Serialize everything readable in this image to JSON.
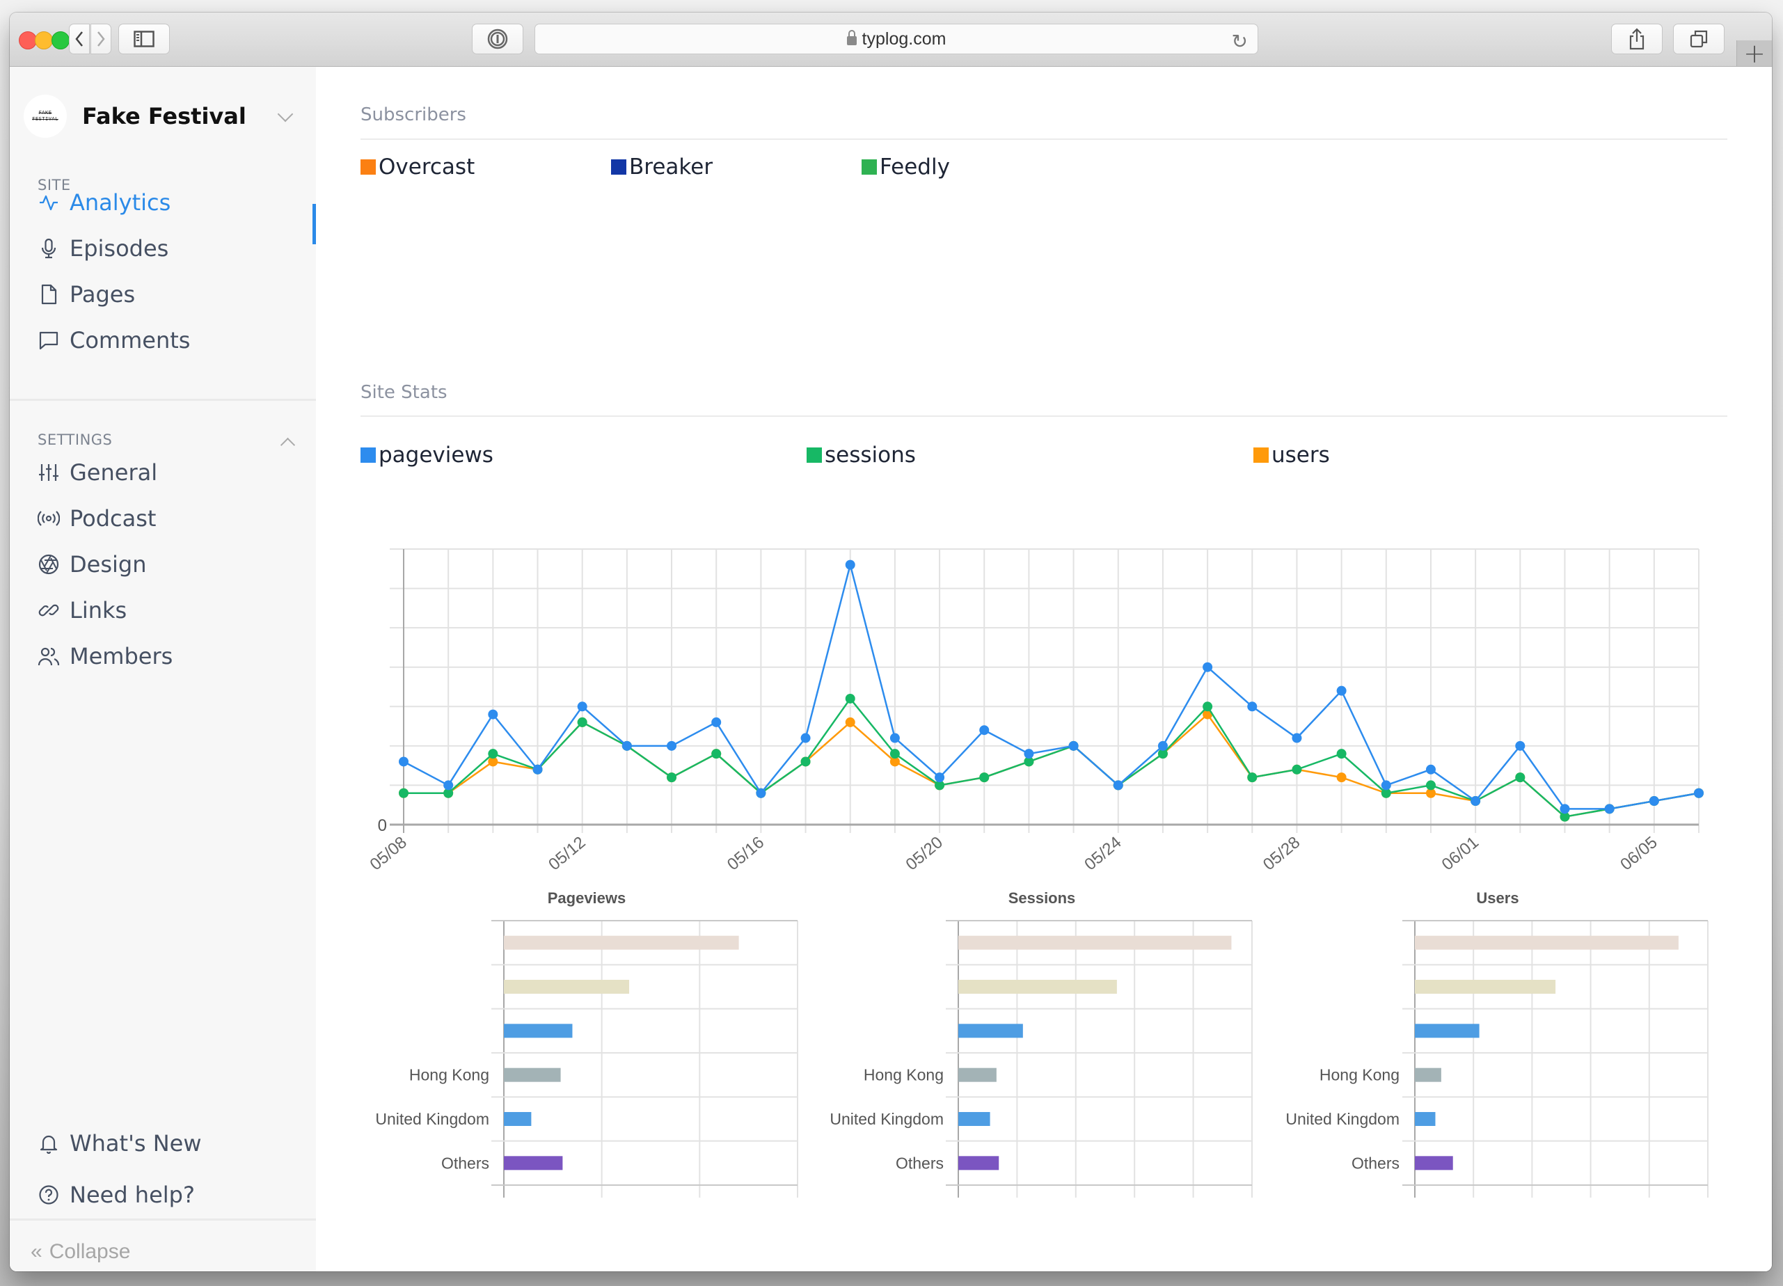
{
  "browser": {
    "url": "typlog.com",
    "buttons": {
      "back": "chevron-left-icon",
      "forward": "chevron-right-icon",
      "sidebar": "sidebar-icon",
      "password": "1password-icon",
      "reload": "reload-icon",
      "share": "share-icon",
      "tabs": "tabs-icon",
      "new_tab": "+"
    }
  },
  "sidebar": {
    "site_name": "Fake Festival",
    "logo_text": [
      "FAKE",
      "FESTIVAL"
    ],
    "site_section_label": "SITE",
    "site_items": [
      {
        "label": "Analytics",
        "icon": "activity-icon",
        "active": true
      },
      {
        "label": "Episodes",
        "icon": "microphone-icon",
        "active": false
      },
      {
        "label": "Pages",
        "icon": "file-icon",
        "active": false
      },
      {
        "label": "Comments",
        "icon": "comment-icon",
        "active": false
      }
    ],
    "settings_section_label": "SETTINGS",
    "settings_items": [
      {
        "label": "General",
        "icon": "sliders-icon"
      },
      {
        "label": "Podcast",
        "icon": "broadcast-icon"
      },
      {
        "label": "Design",
        "icon": "aperture-icon"
      },
      {
        "label": "Links",
        "icon": "link-icon"
      },
      {
        "label": "Members",
        "icon": "users-icon"
      }
    ],
    "footer_items": [
      {
        "label": "What's New",
        "icon": "bell-icon"
      },
      {
        "label": "Need help?",
        "icon": "help-circle-icon"
      }
    ],
    "collapse_label": "Collapse",
    "accent_color": "#2b8ae8"
  },
  "subscribers": {
    "title": "Subscribers",
    "legend": [
      {
        "label": "Overcast",
        "color": "#fb8013"
      },
      {
        "label": "Breaker",
        "color": "#1237a6"
      },
      {
        "label": "Feedly",
        "color": "#2fb252"
      }
    ]
  },
  "site_stats": {
    "title": "Site Stats",
    "legend": [
      {
        "label": "pageviews",
        "color": "#2d8cee"
      },
      {
        "label": "sessions",
        "color": "#17b865"
      },
      {
        "label": "users",
        "color": "#ff9a0a"
      }
    ]
  },
  "chart_data": [
    {
      "type": "line",
      "title": "Site Stats",
      "xlabel": "",
      "ylabel": "",
      "grid": true,
      "y_tick_labels": [
        "0"
      ],
      "ylim": [
        0,
        35
      ],
      "note": "y values are relative units (one horizontal gridline = 5 units); only the 0 tick is labeled",
      "x": [
        "05/08",
        "05/09",
        "05/10",
        "05/11",
        "05/12",
        "05/13",
        "05/14",
        "05/15",
        "05/16",
        "05/17",
        "05/18",
        "05/19",
        "05/20",
        "05/21",
        "05/22",
        "05/23",
        "05/24",
        "05/25",
        "05/26",
        "05/27",
        "05/28",
        "05/29",
        "05/30",
        "05/31",
        "06/01",
        "06/02",
        "06/03",
        "06/04",
        "06/05",
        "06/06"
      ],
      "x_tick_labels": [
        "05/08",
        "05/12",
        "05/16",
        "05/20",
        "05/24",
        "05/28",
        "06/01",
        "06/05"
      ],
      "series": [
        {
          "name": "users",
          "color": "#ff9a0a",
          "values": [
            4,
            4,
            8,
            7,
            13,
            10,
            6,
            9,
            4,
            8,
            13,
            8,
            5,
            6,
            8,
            10,
            5,
            9,
            14,
            6,
            7,
            6,
            4,
            4,
            3,
            6,
            1,
            2,
            3,
            4
          ]
        },
        {
          "name": "sessions",
          "color": "#17b865",
          "values": [
            4,
            4,
            9,
            7,
            13,
            10,
            6,
            9,
            4,
            8,
            16,
            9,
            5,
            6,
            8,
            10,
            5,
            9,
            15,
            6,
            7,
            9,
            4,
            5,
            3,
            6,
            1,
            2,
            3,
            4
          ]
        },
        {
          "name": "pageviews",
          "color": "#2d8cee",
          "values": [
            8,
            5,
            14,
            7,
            15,
            10,
            10,
            13,
            4,
            11,
            33,
            11,
            6,
            12,
            9,
            10,
            5,
            10,
            20,
            15,
            11,
            17,
            5,
            7,
            3,
            10,
            2,
            2,
            3,
            4
          ]
        }
      ]
    },
    {
      "type": "bar",
      "orientation": "horizontal",
      "title": "Pageviews",
      "note": "values in gridline units (axis shows 3 unlabeled gridline intervals)",
      "xlim": [
        0,
        3
      ],
      "categories": [
        "",
        "",
        "",
        "Hong Kong",
        "United Kingdom",
        "Others"
      ],
      "values": [
        2.4,
        1.28,
        0.7,
        0.58,
        0.28,
        0.6
      ],
      "colors": [
        "#e9ddd5",
        "#e5e1c5",
        "#4e9de3",
        "#a3b3b6",
        "#4e9de3",
        "#7b55c1"
      ]
    },
    {
      "type": "bar",
      "orientation": "horizontal",
      "title": "Sessions",
      "note": "values in gridline units (axis shows 5 unlabeled gridline intervals)",
      "xlim": [
        0,
        5
      ],
      "categories": [
        "",
        "",
        "",
        "Hong Kong",
        "United Kingdom",
        "Others"
      ],
      "values": [
        4.65,
        2.7,
        1.1,
        0.65,
        0.54,
        0.69
      ],
      "colors": [
        "#e9ddd5",
        "#e5e1c5",
        "#4e9de3",
        "#a3b3b6",
        "#4e9de3",
        "#7b55c1"
      ]
    },
    {
      "type": "bar",
      "orientation": "horizontal",
      "title": "Users",
      "note": "values in gridline units (axis shows 5 unlabeled gridline intervals)",
      "xlim": [
        0,
        5
      ],
      "categories": [
        "",
        "",
        "",
        "Hong Kong",
        "United Kingdom",
        "Others"
      ],
      "values": [
        4.5,
        2.4,
        1.1,
        0.45,
        0.35,
        0.65
      ],
      "colors": [
        "#e9ddd5",
        "#e5e1c5",
        "#4e9de3",
        "#a3b3b6",
        "#4e9de3",
        "#7b55c1"
      ]
    }
  ]
}
